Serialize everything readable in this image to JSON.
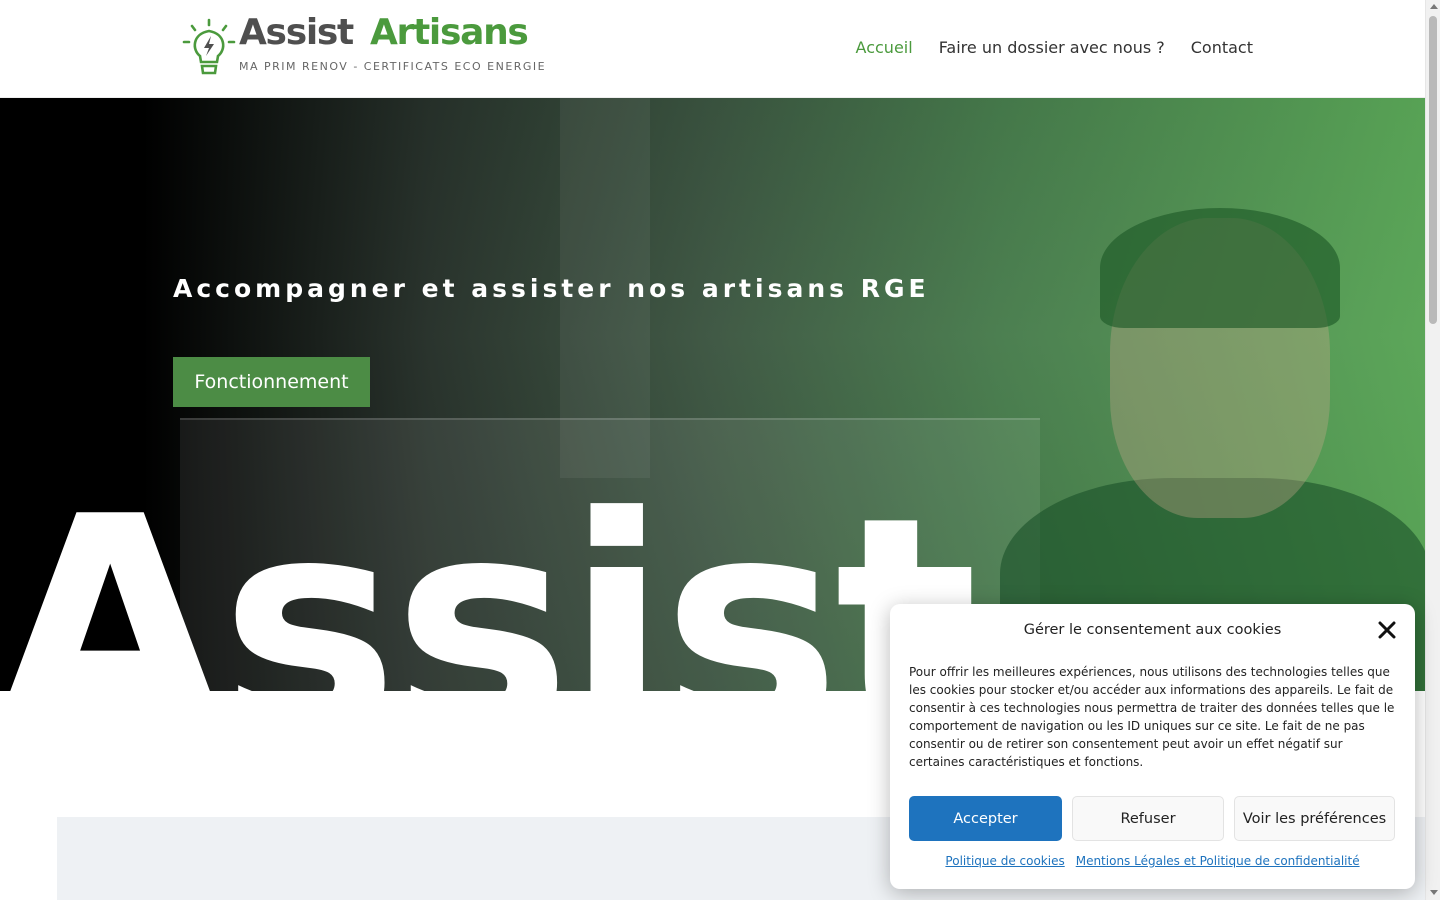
{
  "header": {
    "logo": {
      "word1": "Assist",
      "word2": "Artisans",
      "tagline": "MA PRIM RENOV - CERTIFICATS ECO ENERGIE"
    },
    "nav": [
      {
        "label": "Accueil",
        "active": true
      },
      {
        "label": "Faire un dossier avec nous ?",
        "active": false
      },
      {
        "label": "Contact",
        "active": false
      }
    ]
  },
  "hero": {
    "title": "Accompagner et assister nos artisans RGE",
    "cta_label": "Fonctionnement",
    "big_word": "Assist"
  },
  "cookie_modal": {
    "title": "Gérer le consentement aux cookies",
    "body": "Pour offrir les meilleures expériences, nous utilisons des technologies telles que les cookies pour stocker et/ou accéder aux informations des appareils. Le fait de consentir à ces technologies nous permettra de traiter des données telles que le comportement de navigation ou les ID uniques sur ce site. Le fait de ne pas consentir ou de retirer son consentement peut avoir un effet négatif sur certaines caractéristiques et fonctions.",
    "buttons": {
      "accept": "Accepter",
      "refuse": "Refuser",
      "preferences": "Voir les préférences"
    },
    "links": [
      "Politique de cookies",
      "Mentions Légales et Politique de confidentialité"
    ]
  },
  "colors": {
    "brand_green": "#4b9a3d",
    "cta_green": "#4c8c45",
    "accept_blue": "#1e73be",
    "logo_gray": "#4f4f4f"
  },
  "icons": [
    "lightbulb-logo-icon",
    "close-icon"
  ]
}
